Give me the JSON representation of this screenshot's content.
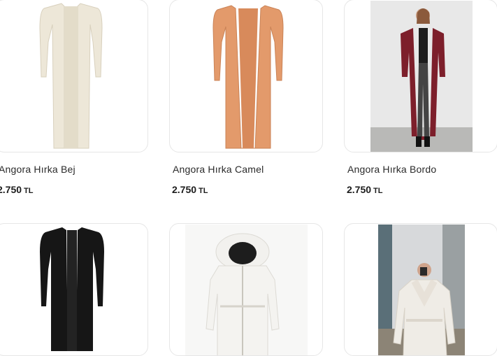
{
  "products": [
    {
      "name": "Angora Hırka Bej",
      "price": "2.750",
      "currency": "TL",
      "icon": "beige-cardigan-image"
    },
    {
      "name": "Angora Hırka Camel",
      "price": "2.750",
      "currency": "TL",
      "icon": "camel-cardigan-image"
    },
    {
      "name": "Angora Hırka Bordo",
      "price": "2.750",
      "currency": "TL",
      "icon": "burgundy-cardigan-image"
    },
    {
      "icon": "black-cardigan-image"
    },
    {
      "icon": "white-parka-image"
    },
    {
      "icon": "white-fur-coat-image"
    }
  ],
  "colors": {
    "beige": "#ede7d8",
    "camel": "#e39a6b",
    "burgundy": "#7d1f2b",
    "black": "#161616",
    "white": "#f4f3f0"
  }
}
